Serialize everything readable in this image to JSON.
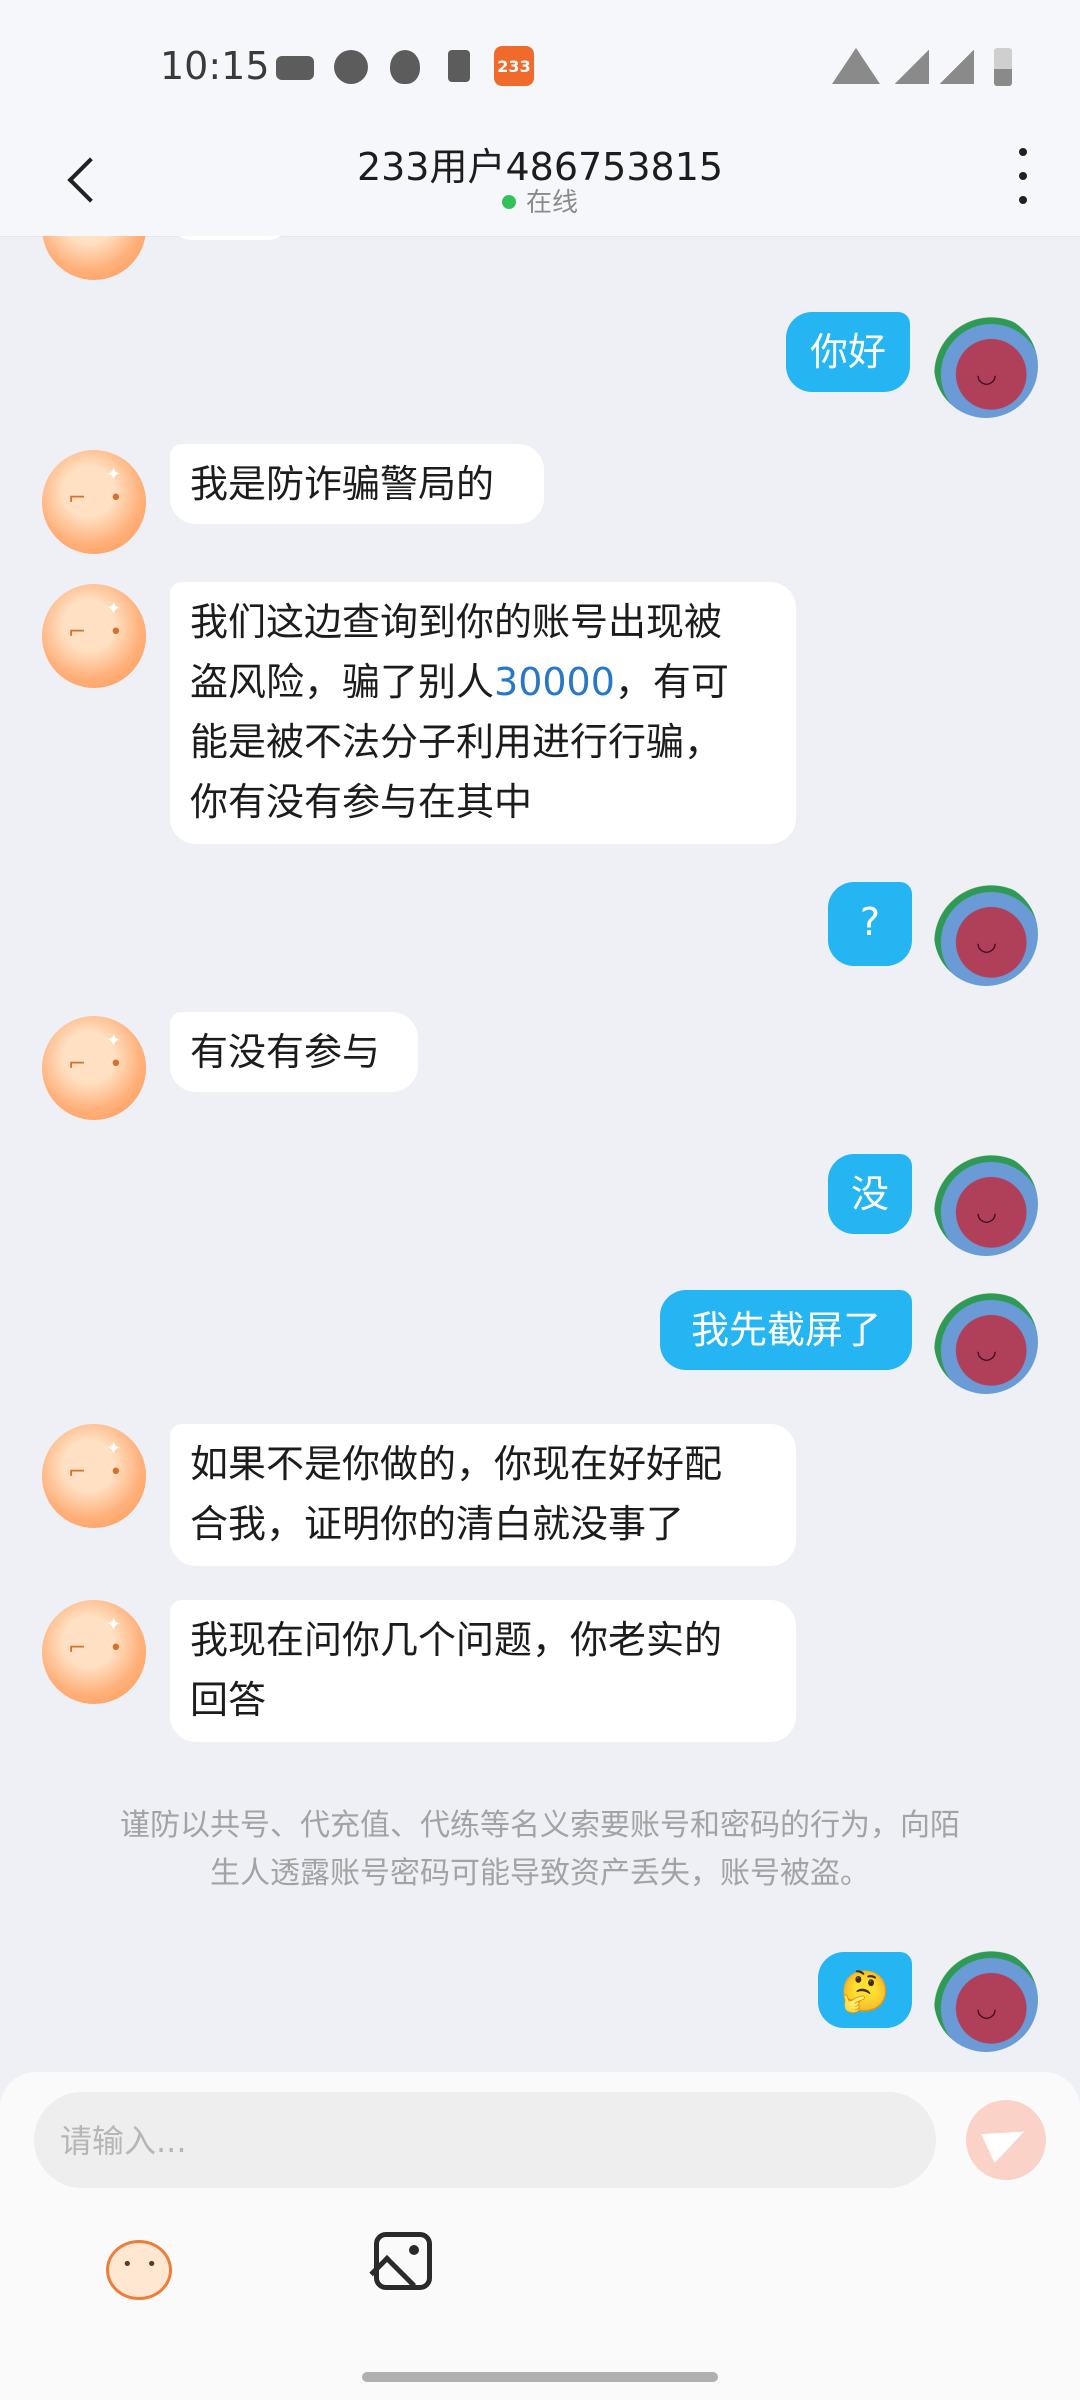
{
  "status_bar": {
    "time": "10:15",
    "badge": "233",
    "icons": [
      "gamepad-icon",
      "face-icon",
      "shield-icon",
      "download-icon",
      "app-233-icon",
      "wifi-icon",
      "signal-icon",
      "signal-x-icon",
      "battery-icon"
    ]
  },
  "header": {
    "title": "233用户486753815",
    "status": "在线",
    "status_color": "#33c25a"
  },
  "messages": [
    {
      "side": "out",
      "text": "你好"
    },
    {
      "side": "in",
      "text": "我是防诈骗警局的"
    },
    {
      "side": "in",
      "lines": [
        "我们这边查询到你的账号出现被",
        "盗风险，骗了别人",
        "30000",
        "，有可",
        "能是被不法分子利用进行行骗，",
        "你有没有参与在其中"
      ]
    },
    {
      "side": "out",
      "text": "?"
    },
    {
      "side": "in",
      "text": "有没有参与"
    },
    {
      "side": "out",
      "text": "没"
    },
    {
      "side": "out",
      "text": "我先截屏了"
    },
    {
      "side": "in",
      "lines": [
        "如果不是你做的，你现在好好配",
        "合我，证明你的清白就没事了"
      ]
    },
    {
      "side": "in",
      "lines": [
        "我现在问你几个问题，你老实的",
        "回答"
      ]
    },
    {
      "side": "out",
      "text": "🤔"
    }
  ],
  "notice": {
    "line1": "谨防以共号、代充值、代练等名义索要账号和密码的行为，向陌",
    "line2": "生人透露账号密码可能导致资产丢失，账号被盗。"
  },
  "input": {
    "placeholder": "请输入..."
  },
  "colors": {
    "outgoing_bubble": "#25b5f2",
    "incoming_bubble": "#ffffff",
    "highlight_number": "#2878c8",
    "send_button": "#fbd2c8"
  }
}
